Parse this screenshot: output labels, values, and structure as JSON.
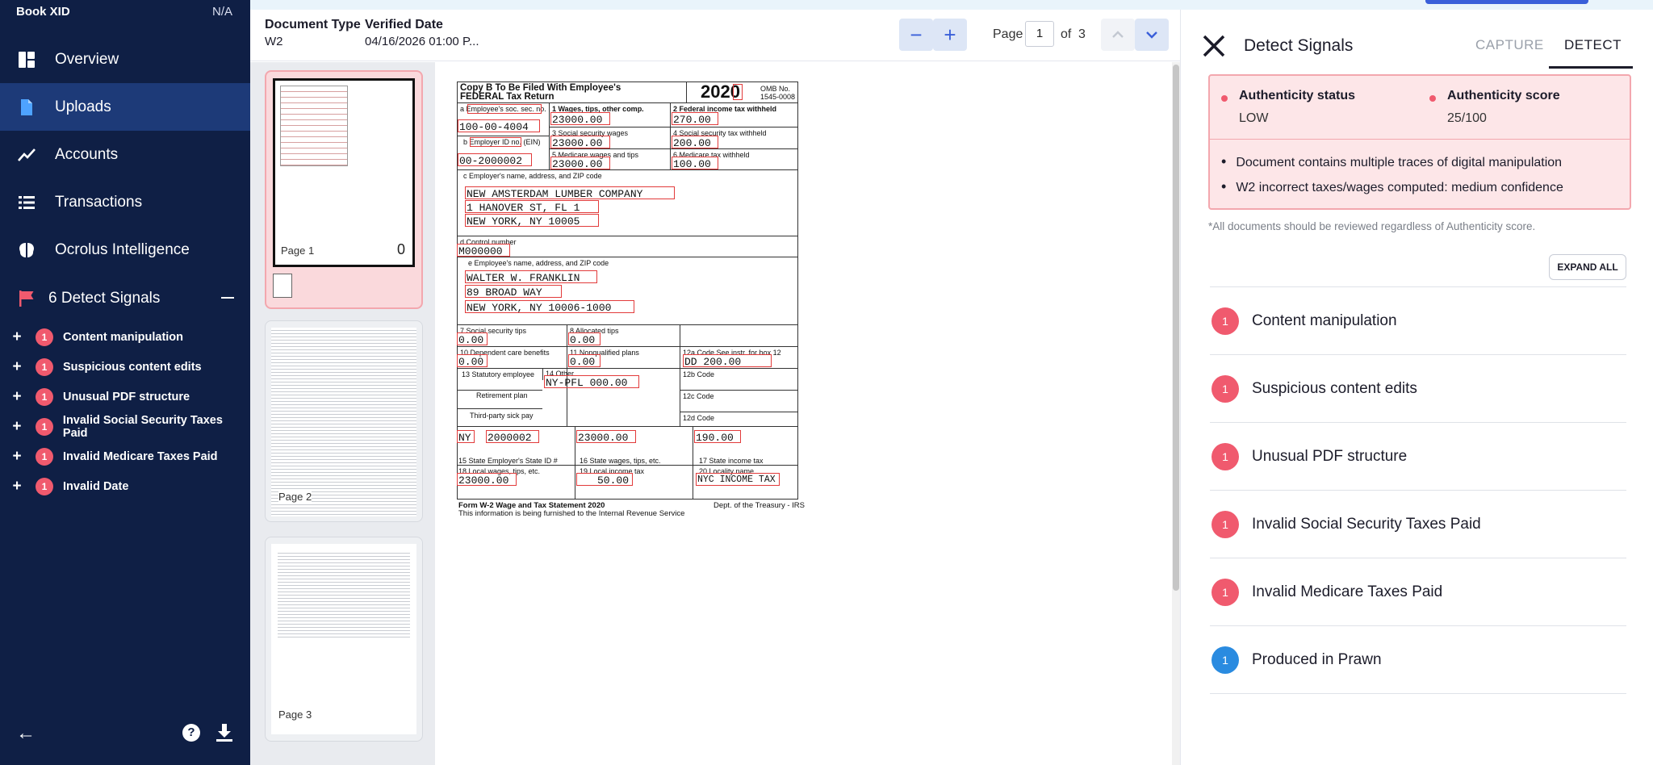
{
  "sidebar": {
    "top_left": "Book XID",
    "top_right": "N/A",
    "nav": [
      {
        "label": "Overview",
        "icon": "dashboard-icon"
      },
      {
        "label": "Uploads",
        "icon": "document-icon"
      },
      {
        "label": "Accounts",
        "icon": "trend-line-icon"
      },
      {
        "label": "Transactions",
        "icon": "list-icon"
      },
      {
        "label": "Ocrolus Intelligence",
        "icon": "brain-icon"
      }
    ],
    "signals_header": "6 Detect Signals",
    "signals": [
      {
        "count": "1",
        "label": "Content manipulation"
      },
      {
        "count": "1",
        "label": "Suspicious content edits"
      },
      {
        "count": "1",
        "label": "Unusual PDF structure"
      },
      {
        "count": "1",
        "label": "Invalid Social Security Taxes Paid"
      },
      {
        "count": "1",
        "label": "Invalid Medicare Taxes Paid"
      },
      {
        "count": "1",
        "label": "Invalid Date"
      }
    ]
  },
  "header": {
    "doc_type_label": "Document Type",
    "doc_type_value": "W2",
    "verified_label": "Verified Date",
    "verified_value": "04/16/2026 01:00 P...",
    "zoom_out": "−",
    "zoom_in": "+",
    "page_label": "Page",
    "page_current": "1",
    "page_of": "of",
    "page_total": "3"
  },
  "thumbnails": [
    {
      "caption": "Page 1",
      "number": "0"
    },
    {
      "caption": "Page 2"
    },
    {
      "caption": "Page 3"
    }
  ],
  "w2": {
    "copy_b": "Copy B To Be Filed With Employee's",
    "federal": "FEDERAL Tax Return",
    "year": "2020",
    "omb": "OMB No.",
    "omb_num": "1545-0008",
    "box_a": "a Employee's soc. sec. no.",
    "ssn": "100-00-4004",
    "box1": "1 Wages, tips, other comp.",
    "v1": "23000.00",
    "box2": "2 Federal income tax withheld",
    "v2": "270.00",
    "box_b": "b Employer ID no. (EIN)",
    "ein": "00-2000002",
    "box3": "3 Social security wages",
    "v3": "23000.00",
    "box4": "4 Social security tax withheld",
    "v4": "200.00",
    "box5": "5 Medicare wages and tips",
    "v5": "23000.00",
    "box6": "6 Medicare tax withheld",
    "v6": "100.00",
    "box_c": "c Employer's name, address, and ZIP code",
    "emp1": "NEW AMSTERDAM LUMBER COMPANY",
    "emp2": "1 HANOVER ST, FL 1",
    "emp3": "NEW YORK, NY 10005",
    "box_d": "d Control number",
    "ctrl": "M000000",
    "box_e": "e Employee's name, address, and ZIP code",
    "ee1": "WALTER W. FRANKLIN",
    "ee2": "89 BROAD WAY",
    "ee3": "NEW YORK, NY 10006-1000",
    "box7": "7 Social security tips",
    "v7": "0.00",
    "box8": "8 Allocated tips",
    "v8": "0.00",
    "box10": "10 Dependent care benefits",
    "v10": "0.00",
    "box11": "11 Nonqualified plans",
    "v11": "0.00",
    "box12a": "12a Code See instr. for box 12",
    "v12a": "DD     200.00",
    "box13": "13 Statutory employee",
    "box14": "14 Other",
    "v14": "NY-PFL 000.00",
    "box12b": "12b Code",
    "retire": "Retirement plan",
    "box12c": "12c Code",
    "sick": "Third-party sick pay",
    "box12d": "12d Code",
    "v15": "NY",
    "v15b": "2000002",
    "v16": "23000.00",
    "v17": "190.00",
    "box15": "15 State   Employer's State ID #",
    "box16": "16 State wages, tips, etc.",
    "box17": "17 State income tax",
    "box18": "18 Local wages, tips, etc.",
    "v18": "23000.00",
    "box19": "19 Local income tax",
    "v19": "50.00",
    "box20": "20 Locality name",
    "v20": "NYC INCOME TAX",
    "footer1": "Form W-2 Wage and Tax Statement 2020",
    "footer2": "This information is being furnished to the Internal Revenue Service",
    "footer3": "Dept. of the Treasury - IRS"
  },
  "panel": {
    "title": "Detect Signals",
    "tab_capture": "CAPTURE",
    "tab_detect": "DETECT",
    "auth_status_label": "Authenticity status",
    "auth_status_value": "LOW",
    "auth_score_label": "Authenticity score",
    "auth_score_value": "25/100",
    "bullets": [
      "Document contains multiple traces of digital manipulation",
      "W2 incorrect taxes/wages computed: medium confidence"
    ],
    "note": "*All documents should be reviewed regardless of Authenticity score.",
    "expand_all": "EXPAND ALL",
    "signals": [
      {
        "count": "1",
        "label": "Content manipulation",
        "color": "#f05a6e"
      },
      {
        "count": "1",
        "label": "Suspicious content edits",
        "color": "#f05a6e"
      },
      {
        "count": "1",
        "label": "Unusual PDF structure",
        "color": "#f05a6e"
      },
      {
        "count": "1",
        "label": "Invalid Social Security Taxes Paid",
        "color": "#f05a6e"
      },
      {
        "count": "1",
        "label": "Invalid Medicare Taxes Paid",
        "color": "#f05a6e"
      },
      {
        "count": "1",
        "label": "Produced in Prawn",
        "color": "#2a8be0"
      }
    ]
  },
  "colors": {
    "sidebar_bg": "#0f1f45",
    "active_nav": "#1d3a78",
    "alert_red": "#f05a6e",
    "info_blue": "#2a8be0",
    "accent": "#3a5fd9"
  }
}
